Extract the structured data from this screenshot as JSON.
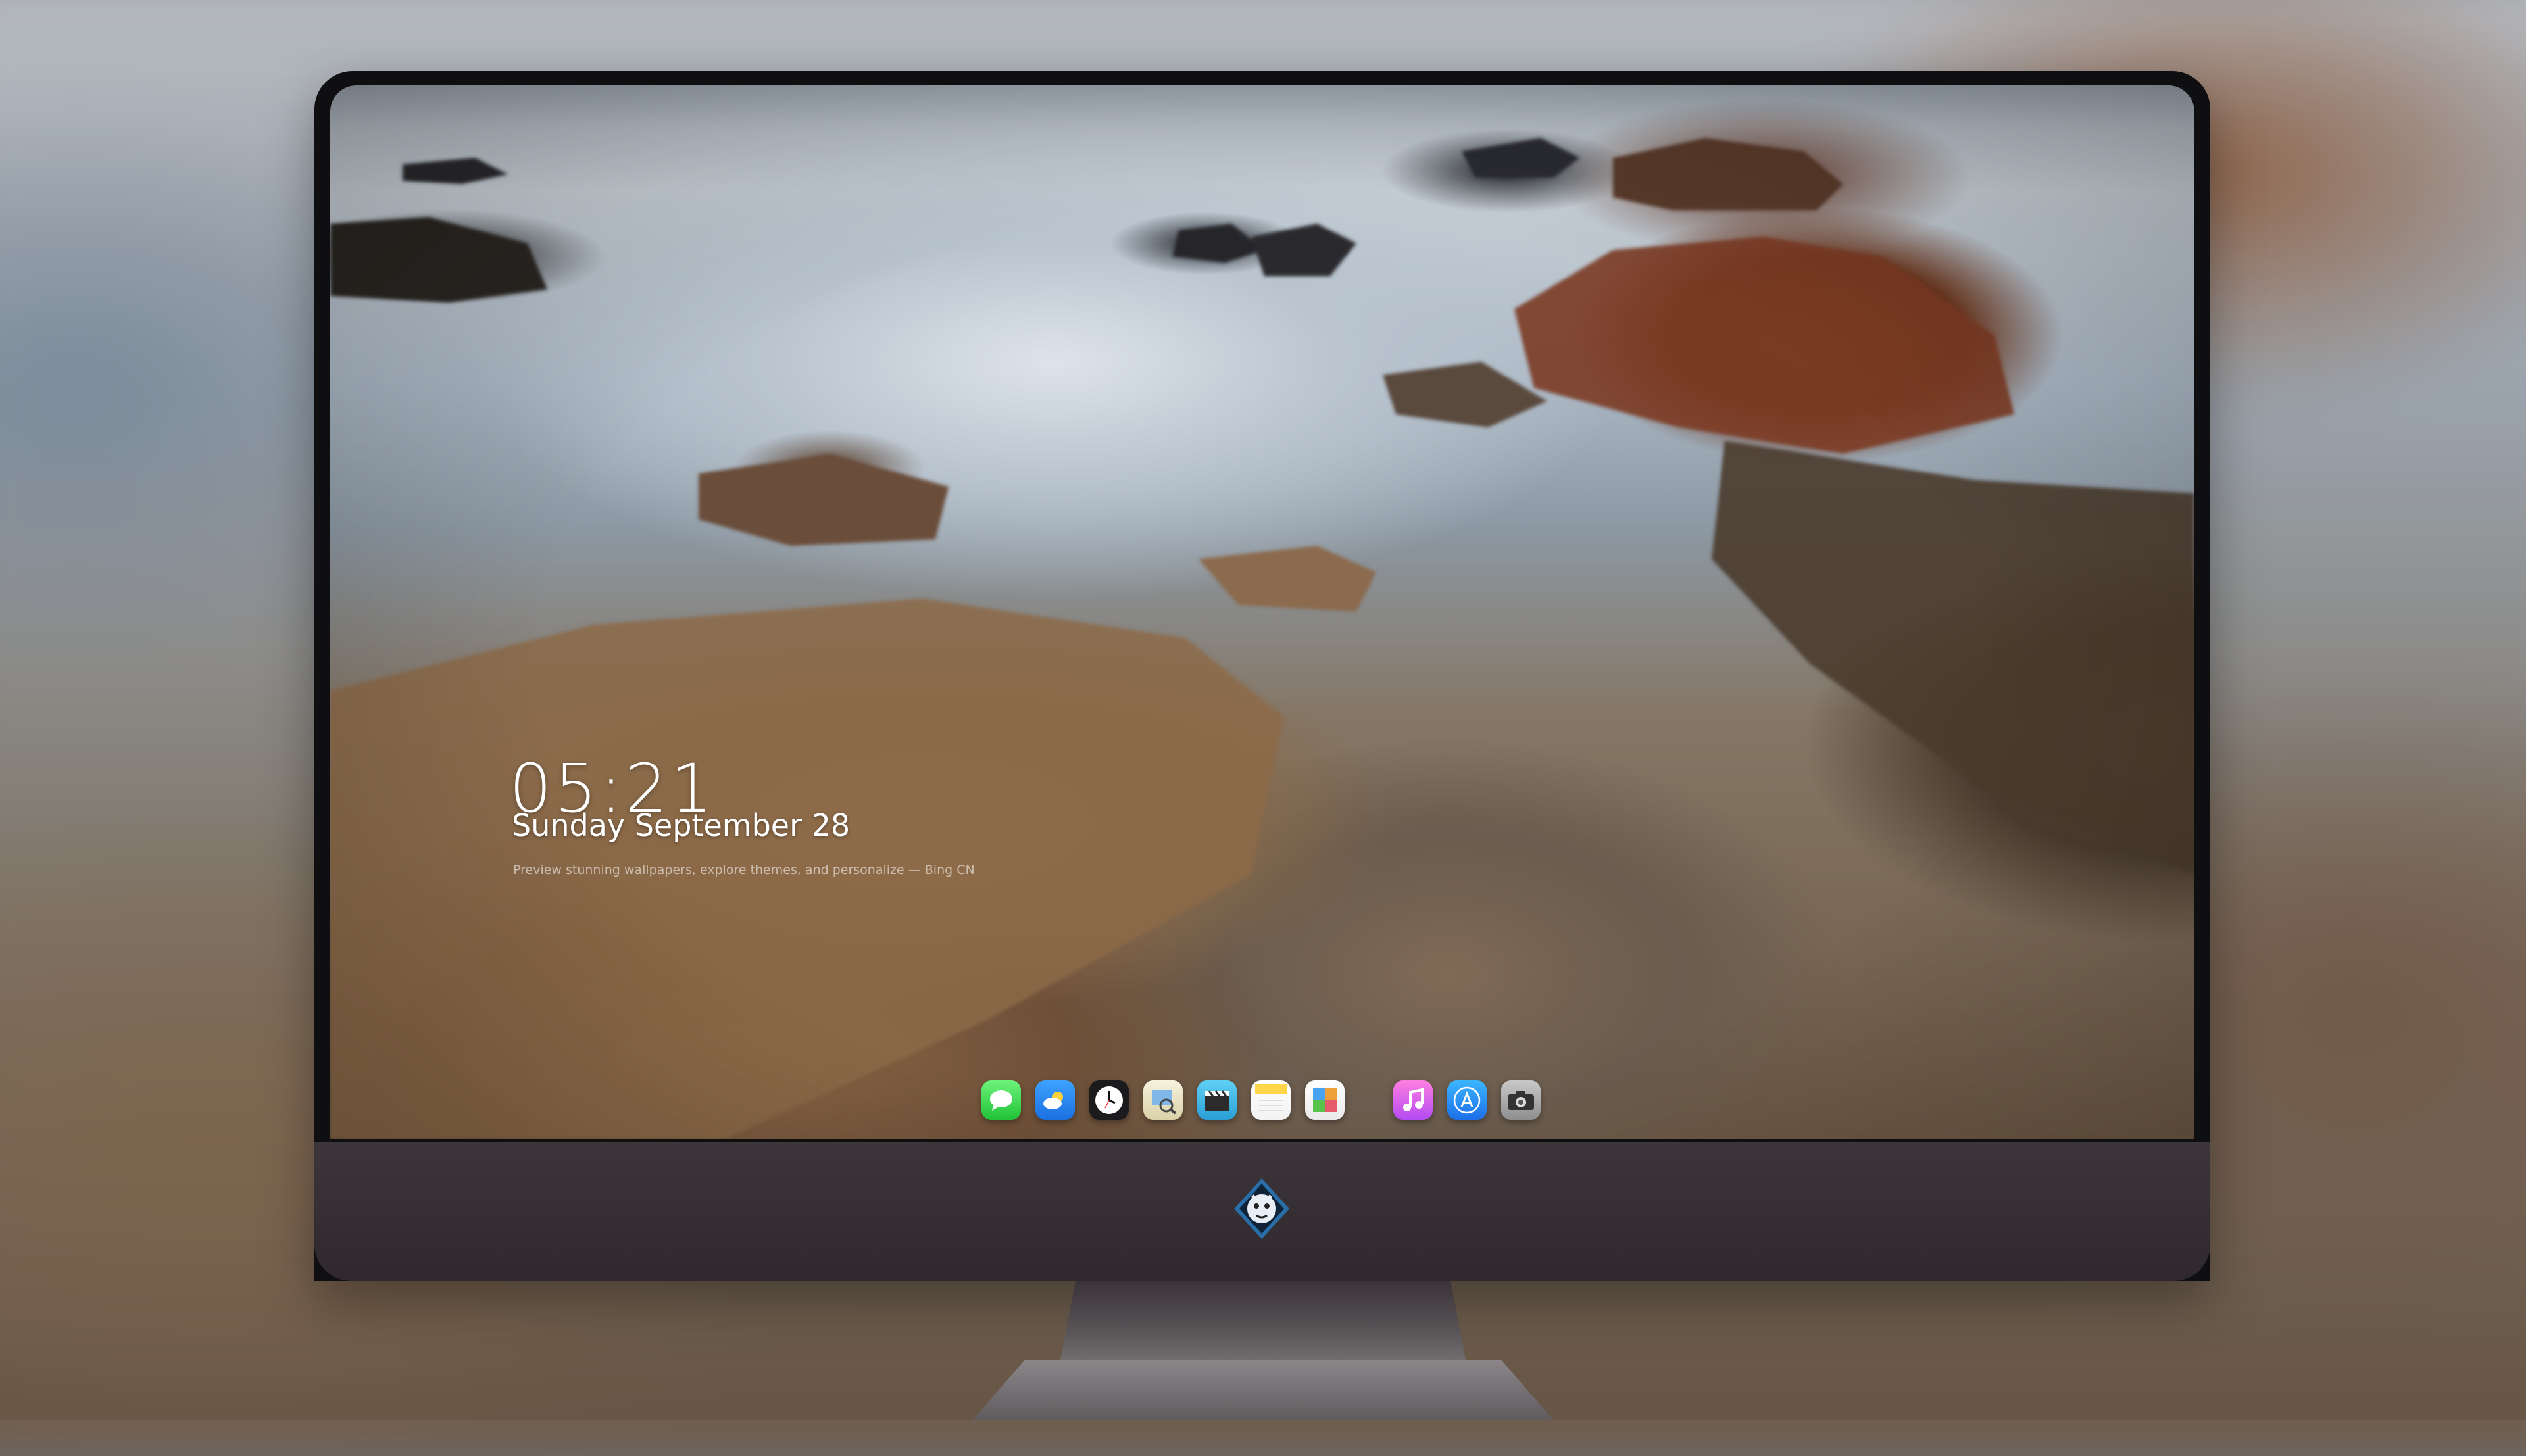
{
  "lockscreen": {
    "time": "05:21",
    "date": "Sunday September  28",
    "credit": "Preview stunning wallpapers, explore themes, and personalize — Bing CN"
  },
  "dock": {
    "apps": [
      {
        "name": "Messages",
        "icon": "messages-icon"
      },
      {
        "name": "Weather",
        "icon": "weather-icon"
      },
      {
        "name": "Clock",
        "icon": "clock-icon"
      },
      {
        "name": "Preview",
        "icon": "preview-icon"
      },
      {
        "name": "Clips",
        "icon": "clips-icon"
      },
      {
        "name": "Notes",
        "icon": "notes-icon"
      },
      {
        "name": "Photos",
        "icon": "photos-icon"
      },
      {
        "name": "Music",
        "icon": "music-icon"
      },
      {
        "name": "App Store",
        "icon": "app-store-icon"
      },
      {
        "name": "Camera",
        "icon": "camera-icon"
      }
    ]
  },
  "brand": {
    "logo": "shield-mascot-logo"
  }
}
